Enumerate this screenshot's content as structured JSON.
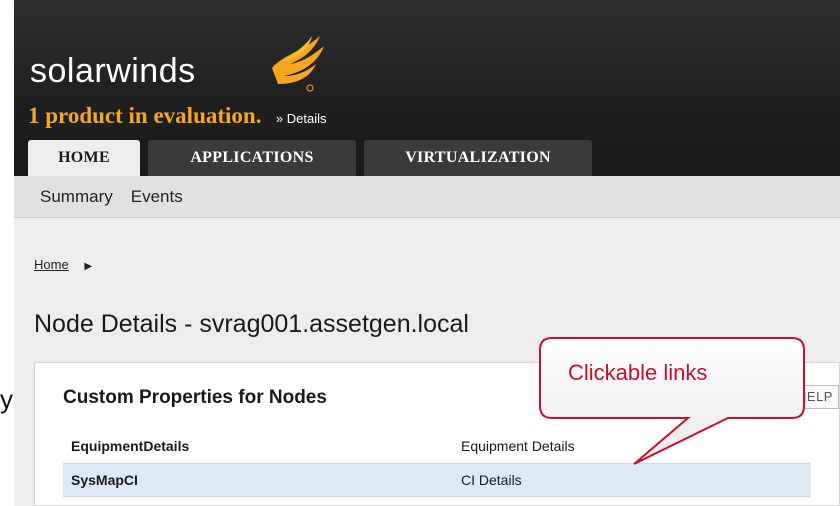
{
  "brand": {
    "logo_text": "solarwinds",
    "flame_color": "#f5a623"
  },
  "evaluation": {
    "message": "1 product in evaluation.",
    "details_link": "» Details"
  },
  "tabs": [
    {
      "label": "HOME",
      "active": true
    },
    {
      "label": "APPLICATIONS",
      "active": false
    },
    {
      "label": "VIRTUALIZATION",
      "active": false
    }
  ],
  "subnav": {
    "items": [
      "Summary",
      "Events"
    ]
  },
  "breadcrumb": {
    "home": "Home",
    "arrow": "▶"
  },
  "page": {
    "title": "Node Details - svrag001.assetgen.local"
  },
  "panel": {
    "title": "Custom Properties for Nodes",
    "help_label": "HELP",
    "rows": [
      {
        "name": "EquipmentDetails",
        "value": "Equipment Details"
      },
      {
        "name": "SysMapCI",
        "value": "CI Details"
      }
    ]
  },
  "annotation": {
    "callout_text": "Clickable links",
    "stray_glyph": "y"
  },
  "colors": {
    "header_bg": "#1f1f1f",
    "accent_orange": "#f5a623",
    "callout_red": "#c8102e",
    "row_highlight": "#dde9f5"
  }
}
